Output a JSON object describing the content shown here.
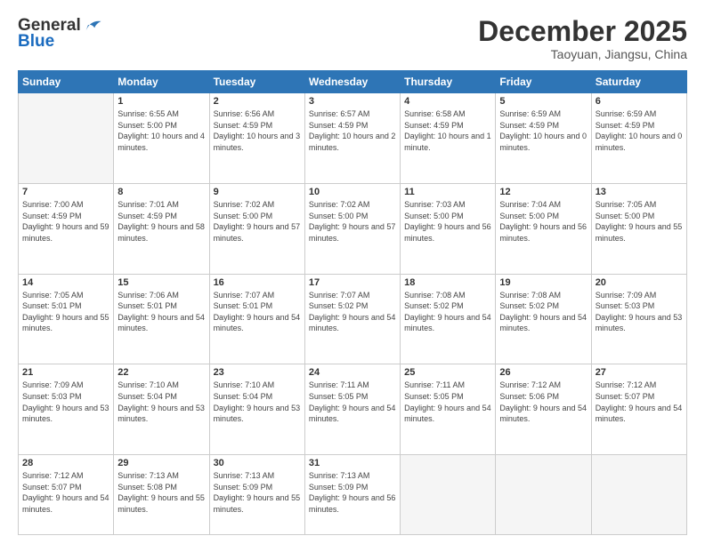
{
  "header": {
    "logo_line1": "General",
    "logo_line2": "Blue",
    "month": "December 2025",
    "location": "Taoyuan, Jiangsu, China"
  },
  "days_of_week": [
    "Sunday",
    "Monday",
    "Tuesday",
    "Wednesday",
    "Thursday",
    "Friday",
    "Saturday"
  ],
  "weeks": [
    [
      {
        "day": "",
        "empty": true
      },
      {
        "day": "1",
        "sunrise": "6:55 AM",
        "sunset": "5:00 PM",
        "daylight": "10 hours and 4 minutes."
      },
      {
        "day": "2",
        "sunrise": "6:56 AM",
        "sunset": "4:59 PM",
        "daylight": "10 hours and 3 minutes."
      },
      {
        "day": "3",
        "sunrise": "6:57 AM",
        "sunset": "4:59 PM",
        "daylight": "10 hours and 2 minutes."
      },
      {
        "day": "4",
        "sunrise": "6:58 AM",
        "sunset": "4:59 PM",
        "daylight": "10 hours and 1 minute."
      },
      {
        "day": "5",
        "sunrise": "6:59 AM",
        "sunset": "4:59 PM",
        "daylight": "10 hours and 0 minutes."
      },
      {
        "day": "6",
        "sunrise": "6:59 AM",
        "sunset": "4:59 PM",
        "daylight": "10 hours and 0 minutes."
      }
    ],
    [
      {
        "day": "7",
        "sunrise": "7:00 AM",
        "sunset": "4:59 PM",
        "daylight": "9 hours and 59 minutes."
      },
      {
        "day": "8",
        "sunrise": "7:01 AM",
        "sunset": "4:59 PM",
        "daylight": "9 hours and 58 minutes."
      },
      {
        "day": "9",
        "sunrise": "7:02 AM",
        "sunset": "5:00 PM",
        "daylight": "9 hours and 57 minutes."
      },
      {
        "day": "10",
        "sunrise": "7:02 AM",
        "sunset": "5:00 PM",
        "daylight": "9 hours and 57 minutes."
      },
      {
        "day": "11",
        "sunrise": "7:03 AM",
        "sunset": "5:00 PM",
        "daylight": "9 hours and 56 minutes."
      },
      {
        "day": "12",
        "sunrise": "7:04 AM",
        "sunset": "5:00 PM",
        "daylight": "9 hours and 56 minutes."
      },
      {
        "day": "13",
        "sunrise": "7:05 AM",
        "sunset": "5:00 PM",
        "daylight": "9 hours and 55 minutes."
      }
    ],
    [
      {
        "day": "14",
        "sunrise": "7:05 AM",
        "sunset": "5:01 PM",
        "daylight": "9 hours and 55 minutes."
      },
      {
        "day": "15",
        "sunrise": "7:06 AM",
        "sunset": "5:01 PM",
        "daylight": "9 hours and 54 minutes."
      },
      {
        "day": "16",
        "sunrise": "7:07 AM",
        "sunset": "5:01 PM",
        "daylight": "9 hours and 54 minutes."
      },
      {
        "day": "17",
        "sunrise": "7:07 AM",
        "sunset": "5:02 PM",
        "daylight": "9 hours and 54 minutes."
      },
      {
        "day": "18",
        "sunrise": "7:08 AM",
        "sunset": "5:02 PM",
        "daylight": "9 hours and 54 minutes."
      },
      {
        "day": "19",
        "sunrise": "7:08 AM",
        "sunset": "5:02 PM",
        "daylight": "9 hours and 54 minutes."
      },
      {
        "day": "20",
        "sunrise": "7:09 AM",
        "sunset": "5:03 PM",
        "daylight": "9 hours and 53 minutes."
      }
    ],
    [
      {
        "day": "21",
        "sunrise": "7:09 AM",
        "sunset": "5:03 PM",
        "daylight": "9 hours and 53 minutes."
      },
      {
        "day": "22",
        "sunrise": "7:10 AM",
        "sunset": "5:04 PM",
        "daylight": "9 hours and 53 minutes."
      },
      {
        "day": "23",
        "sunrise": "7:10 AM",
        "sunset": "5:04 PM",
        "daylight": "9 hours and 53 minutes."
      },
      {
        "day": "24",
        "sunrise": "7:11 AM",
        "sunset": "5:05 PM",
        "daylight": "9 hours and 54 minutes."
      },
      {
        "day": "25",
        "sunrise": "7:11 AM",
        "sunset": "5:05 PM",
        "daylight": "9 hours and 54 minutes."
      },
      {
        "day": "26",
        "sunrise": "7:12 AM",
        "sunset": "5:06 PM",
        "daylight": "9 hours and 54 minutes."
      },
      {
        "day": "27",
        "sunrise": "7:12 AM",
        "sunset": "5:07 PM",
        "daylight": "9 hours and 54 minutes."
      }
    ],
    [
      {
        "day": "28",
        "sunrise": "7:12 AM",
        "sunset": "5:07 PM",
        "daylight": "9 hours and 54 minutes."
      },
      {
        "day": "29",
        "sunrise": "7:13 AM",
        "sunset": "5:08 PM",
        "daylight": "9 hours and 55 minutes."
      },
      {
        "day": "30",
        "sunrise": "7:13 AM",
        "sunset": "5:09 PM",
        "daylight": "9 hours and 55 minutes."
      },
      {
        "day": "31",
        "sunrise": "7:13 AM",
        "sunset": "5:09 PM",
        "daylight": "9 hours and 56 minutes."
      },
      {
        "day": "",
        "empty": true
      },
      {
        "day": "",
        "empty": true
      },
      {
        "day": "",
        "empty": true
      }
    ]
  ]
}
